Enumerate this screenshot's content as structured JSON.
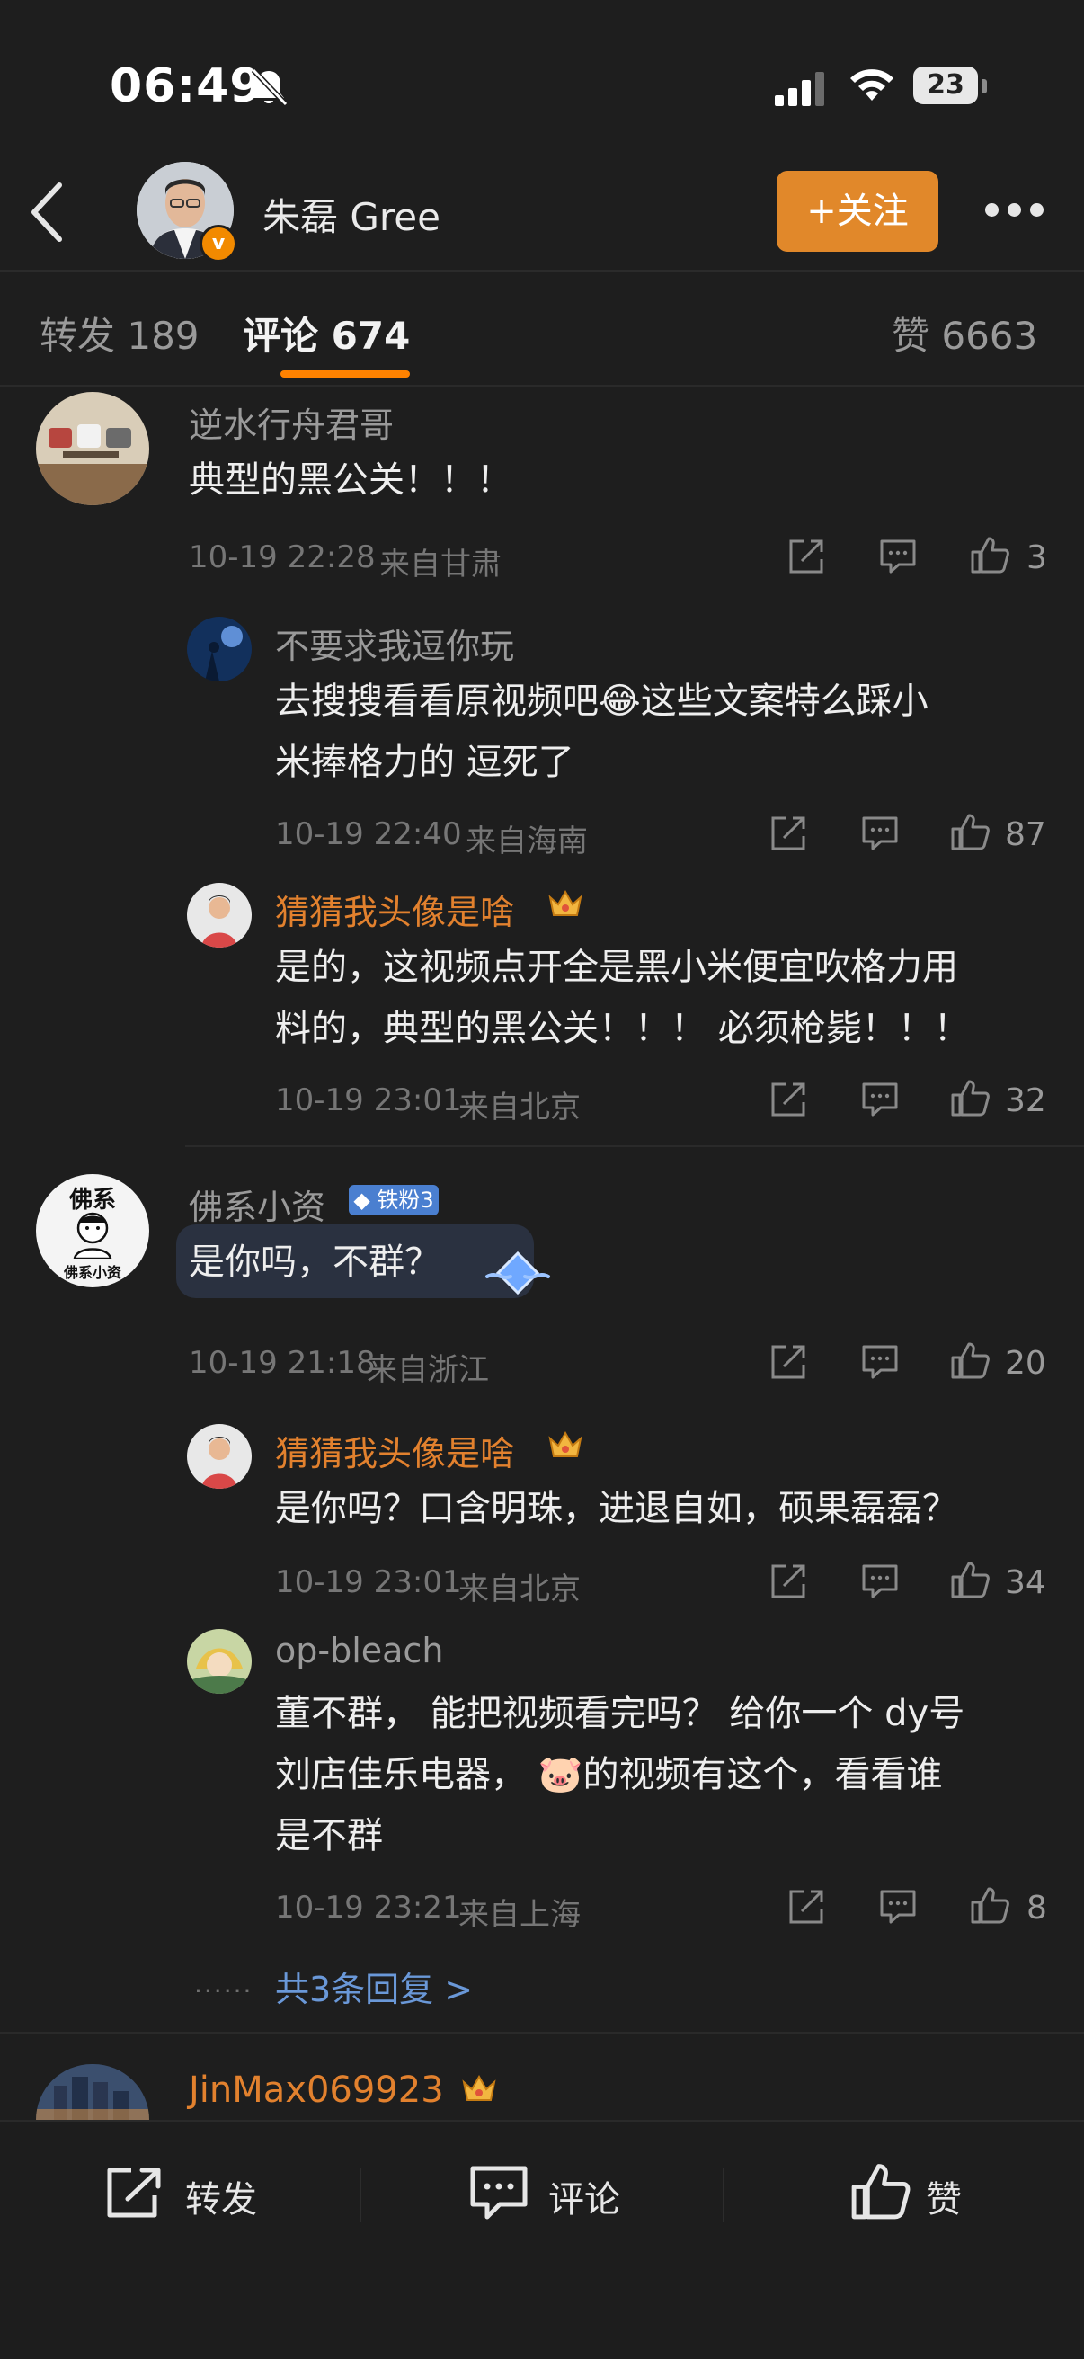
{
  "status_bar": {
    "time": "06:49",
    "battery": "23"
  },
  "header": {
    "name": "朱磊 Gree",
    "follow_label": "+关注"
  },
  "tabs": {
    "repost": "转发 189",
    "comment": "评论 674",
    "likes": "赞 6663"
  },
  "comments": [
    {
      "user": "逆水行舟君哥",
      "text": "典型的黑公关！！！",
      "time": "10-19 22:28",
      "location": "来自甘肃",
      "likes": "3",
      "replies": [
        {
          "user": "不要求我逗你玩",
          "text_line1": "去搜搜看看原视频吧😂这些文案特么踩小",
          "text_line2": "米捧格力的 逗死了",
          "time": "10-19 22:40",
          "location": "来自海南",
          "likes": "87"
        },
        {
          "user": "猜猜我头像是啥",
          "text_line1": "是的，这视频点开全是黑小米便宜吹格力用",
          "text_line2": "料的，典型的黑公关！！！ 必须枪毙！！！",
          "time": "10-19 23:01",
          "location": "来自北京",
          "likes": "32"
        }
      ]
    },
    {
      "user": "佛系小资",
      "badge": "铁粉3",
      "text": "是你吗，不群？",
      "time": "10-19 21:18",
      "location": "来自浙江",
      "likes": "20",
      "replies": [
        {
          "user": "猜猜我头像是啥",
          "text_line1": "是你吗？口含明珠，进退自如，硕果磊磊？",
          "time": "10-19 23:01",
          "location": "来自北京",
          "likes": "34"
        },
        {
          "user": "op-bleach",
          "text_line1": "董不群， 能把视频看完吗？ 给你一个 dy号",
          "text_line2": "刘店佳乐电器， 🐷的视频有这个，看看谁",
          "text_line3": "是不群",
          "time": "10-19 23:21",
          "location": "来自上海",
          "likes": "8"
        }
      ],
      "more_replies": "共3条回复 >"
    },
    {
      "user": "JinMax069923"
    }
  ],
  "avatar_labels": {
    "fxz_top": "佛系",
    "fxz_bottom": "佛系小资"
  },
  "bottom_bar": {
    "repost": "转发",
    "comment": "评论",
    "like": "赞"
  },
  "colors": {
    "accent": "#ff8200",
    "follow": "#e1882a",
    "background": "#1e1e1e"
  }
}
